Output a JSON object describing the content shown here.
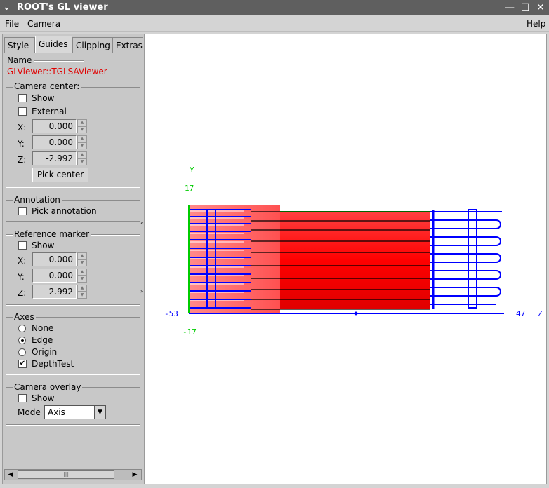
{
  "window": {
    "title": "ROOT's GL viewer"
  },
  "menubar": {
    "file": "File",
    "camera": "Camera",
    "help": "Help"
  },
  "tabs": [
    "Style",
    "Guides",
    "Clipping",
    "Extras"
  ],
  "name_section": {
    "label": "Name",
    "value": "GLViewer::TGLSAViewer"
  },
  "camera_center": {
    "title": "Camera center:",
    "show_label": "Show",
    "show_checked": false,
    "external_label": "External",
    "external_checked": false,
    "x_label": "X:",
    "x": "0.000",
    "y_label": "Y:",
    "y": "0.000",
    "z_label": "Z:",
    "z": "-2.992",
    "pick_button": "Pick center"
  },
  "annotation": {
    "title": "Annotation",
    "pick_label": "Pick annotation",
    "pick_checked": false
  },
  "reference_marker": {
    "title": "Reference marker",
    "show_label": "Show",
    "show_checked": false,
    "x_label": "X:",
    "x": "0.000",
    "y_label": "Y:",
    "y": "0.000",
    "z_label": "Z:",
    "z": "-2.992"
  },
  "axes": {
    "title": "Axes",
    "none_label": "None",
    "edge_label": "Edge",
    "origin_label": "Origin",
    "selected": "Edge",
    "depthtest_label": "DepthTest",
    "depthtest_checked": true
  },
  "camera_overlay": {
    "title": "Camera overlay",
    "show_label": "Show",
    "show_checked": false,
    "mode_label": "Mode",
    "mode_value": "Axis"
  },
  "scene": {
    "y_axis_label": "Y",
    "y_max": "17",
    "y_min": "-17",
    "z_min": "-53",
    "z_max": "47",
    "z_axis_label": "Z",
    "colors": {
      "axis_x": "#0000ff",
      "axis_y": "#00cc00",
      "detector_red": "#ff0000",
      "coil_blue": "#0000ff"
    }
  }
}
